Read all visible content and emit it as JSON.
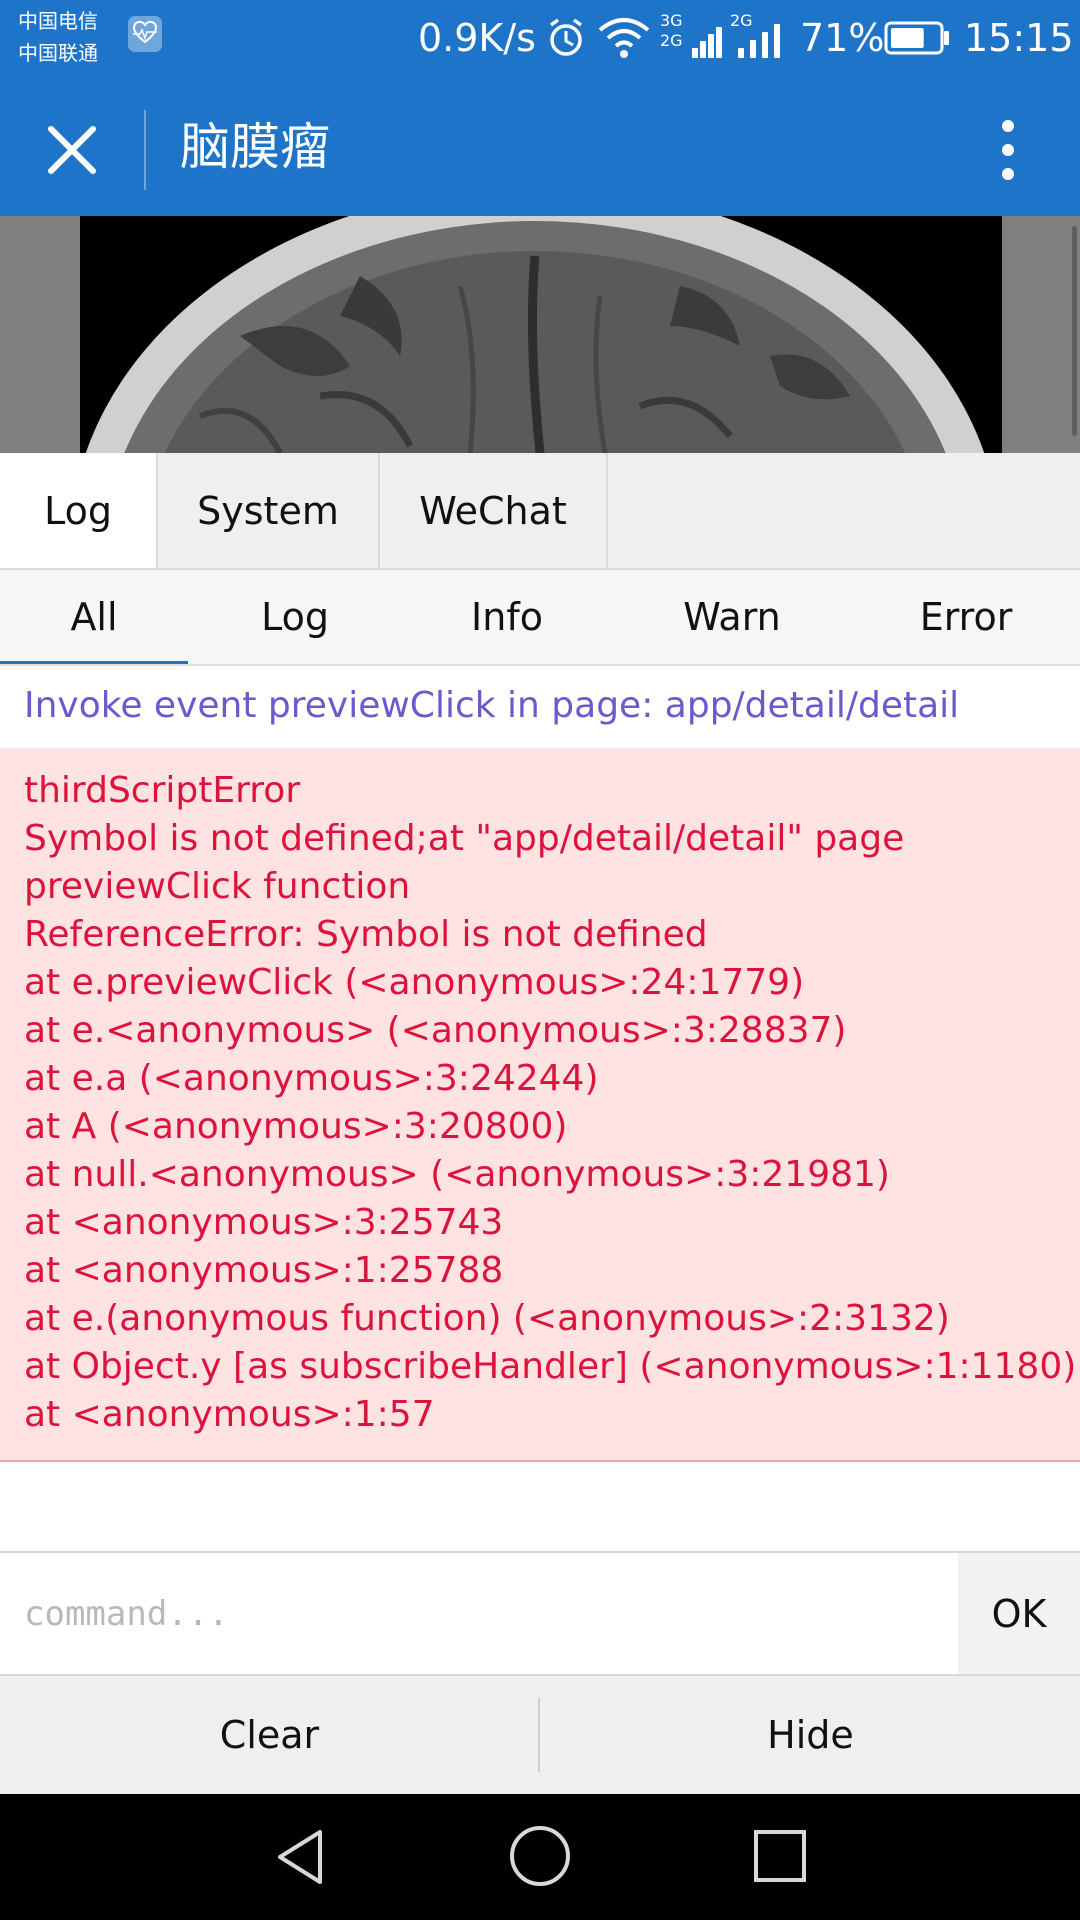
{
  "status_bar": {
    "carrier_1": "中国电信",
    "carrier_2": "中国联通",
    "net_speed": "0.9K/s",
    "sim1_label_top": "3G",
    "sim1_label_bottom": "2G",
    "sim2_label": "2G",
    "battery_percent": "71%",
    "battery_level": 0.71,
    "time": "15:15",
    "icons": [
      "health-icon",
      "alarm-icon",
      "wifi-icon",
      "signal-icon",
      "battery-icon"
    ]
  },
  "title_bar": {
    "title": "脑膜瘤",
    "icons": [
      "close-icon",
      "more-vertical-icon"
    ]
  },
  "top_tabs": [
    {
      "label": "Log",
      "active": true
    },
    {
      "label": "System",
      "active": false
    },
    {
      "label": "WeChat",
      "active": false
    }
  ],
  "filter_tabs": [
    {
      "label": "All",
      "active": true
    },
    {
      "label": "Log",
      "active": false
    },
    {
      "label": "Info",
      "active": false
    },
    {
      "label": "Warn",
      "active": false
    },
    {
      "label": "Error",
      "active": false
    }
  ],
  "logs": {
    "info": "Invoke event previewClick in page: app/detail/detail",
    "error_lines": [
      "thirdScriptError",
      "Symbol is not defined;at \"app/detail/detail\" page",
      "previewClick function",
      "ReferenceError: Symbol is not defined",
      "at e.previewClick (<anonymous>:24:1779)",
      "at e.<anonymous> (<anonymous>:3:28837)",
      "at e.a (<anonymous>:3:24244)",
      "at A (<anonymous>:3:20800)",
      "at null.<anonymous> (<anonymous>:3:21981)",
      "at <anonymous>:3:25743",
      "at <anonymous>:1:25788",
      "at e.(anonymous function) (<anonymous>:2:3132)",
      "at Object.y [as subscribeHandler] (<anonymous>:1:1180)",
      "at <anonymous>:1:57"
    ]
  },
  "command": {
    "placeholder": "command...",
    "value": "",
    "ok_label": "OK"
  },
  "bottom_buttons": {
    "clear_label": "Clear",
    "hide_label": "Hide"
  },
  "nav_bar": {
    "icons": [
      "back-icon",
      "home-icon",
      "recents-icon"
    ]
  },
  "colors": {
    "header_blue": "#1e74c8",
    "info_text": "#6a5acd",
    "error_text": "#dc143c",
    "error_bg": "#ffe2e2"
  }
}
